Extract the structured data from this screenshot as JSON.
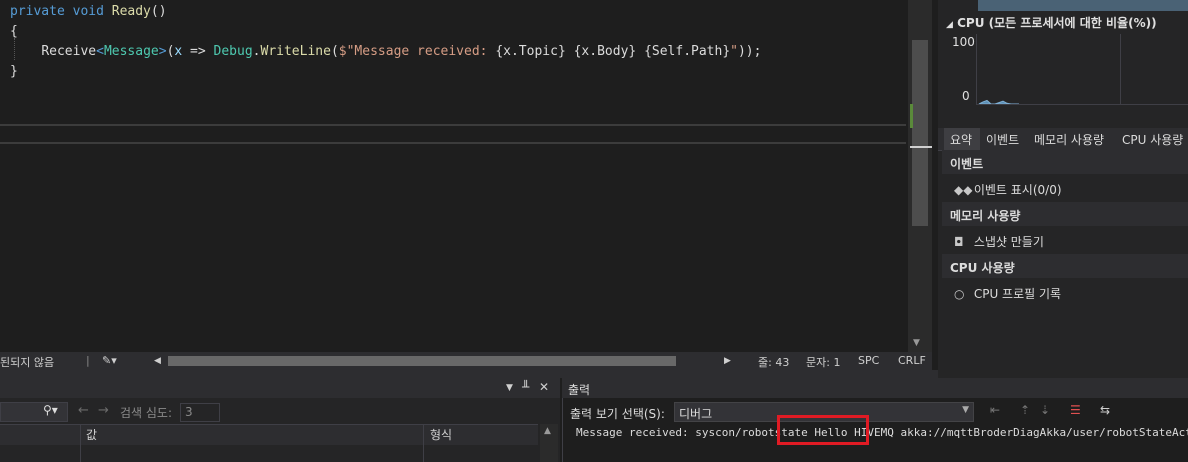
{
  "editor": {
    "lines": [
      {
        "keyword": "private void",
        "name": "Ready",
        "rest": "()"
      },
      {
        "text": "{"
      },
      {
        "indent": "    ",
        "method": "Receive",
        "lt": "<",
        "type": "Message",
        "gt": ">",
        "open": "(",
        "param": "x",
        "arrow": " => ",
        "debug": "Debug",
        "dot": ".",
        "writeline": "WriteLine",
        "paren": "(",
        "str1": "$\"Message received: ",
        "b1": "{x.Topic}",
        "sp1": " ",
        "b2": "{x.Body}",
        "sp2": " ",
        "b3": "{Self.Path}",
        "str2": "\"",
        "close": "));"
      },
      {
        "text": "}"
      }
    ]
  },
  "statusbar": {
    "issue_text": "된되지 않음",
    "line": "줄: 43",
    "col": "문자: 1",
    "spc": "SPC",
    "crlf": "CRLF"
  },
  "diagnostics": {
    "cpu_title": "CPU (모든 프로세서에 대한 비율(%))",
    "y_max": "100",
    "y_min": "0",
    "tabs": [
      "요약",
      "이벤트",
      "메모리 사용량",
      "CPU 사용량"
    ],
    "sections": [
      {
        "title": "이벤트",
        "item": "이벤트 표시(0/0)",
        "icon": "events-icon"
      },
      {
        "title": "메모리 사용량",
        "item": "스냅샷 만들기",
        "icon": "camera-icon"
      },
      {
        "title": "CPU 사용량",
        "item": "CPU 프로필 기록",
        "icon": "record-icon"
      }
    ],
    "chart_data": {
      "type": "area",
      "x": [
        0,
        1,
        2,
        3,
        4,
        5,
        6,
        7,
        8,
        9,
        10
      ],
      "values": [
        0,
        3,
        5,
        0,
        0,
        2,
        4,
        1,
        0,
        0,
        0
      ],
      "ylim": [
        0,
        100
      ]
    }
  },
  "locals": {
    "depth_label": "검색 심도:",
    "depth_value": "3",
    "col_value": "값",
    "col_type": "형식"
  },
  "output": {
    "title": "출력",
    "source_label": "출력 보기 선택(S):",
    "source_value": "디버그",
    "text": "Message received: syscon/robotstate Hello HIVEMQ akka://mqttBroderDiagAkka/user/robotStateActor"
  }
}
